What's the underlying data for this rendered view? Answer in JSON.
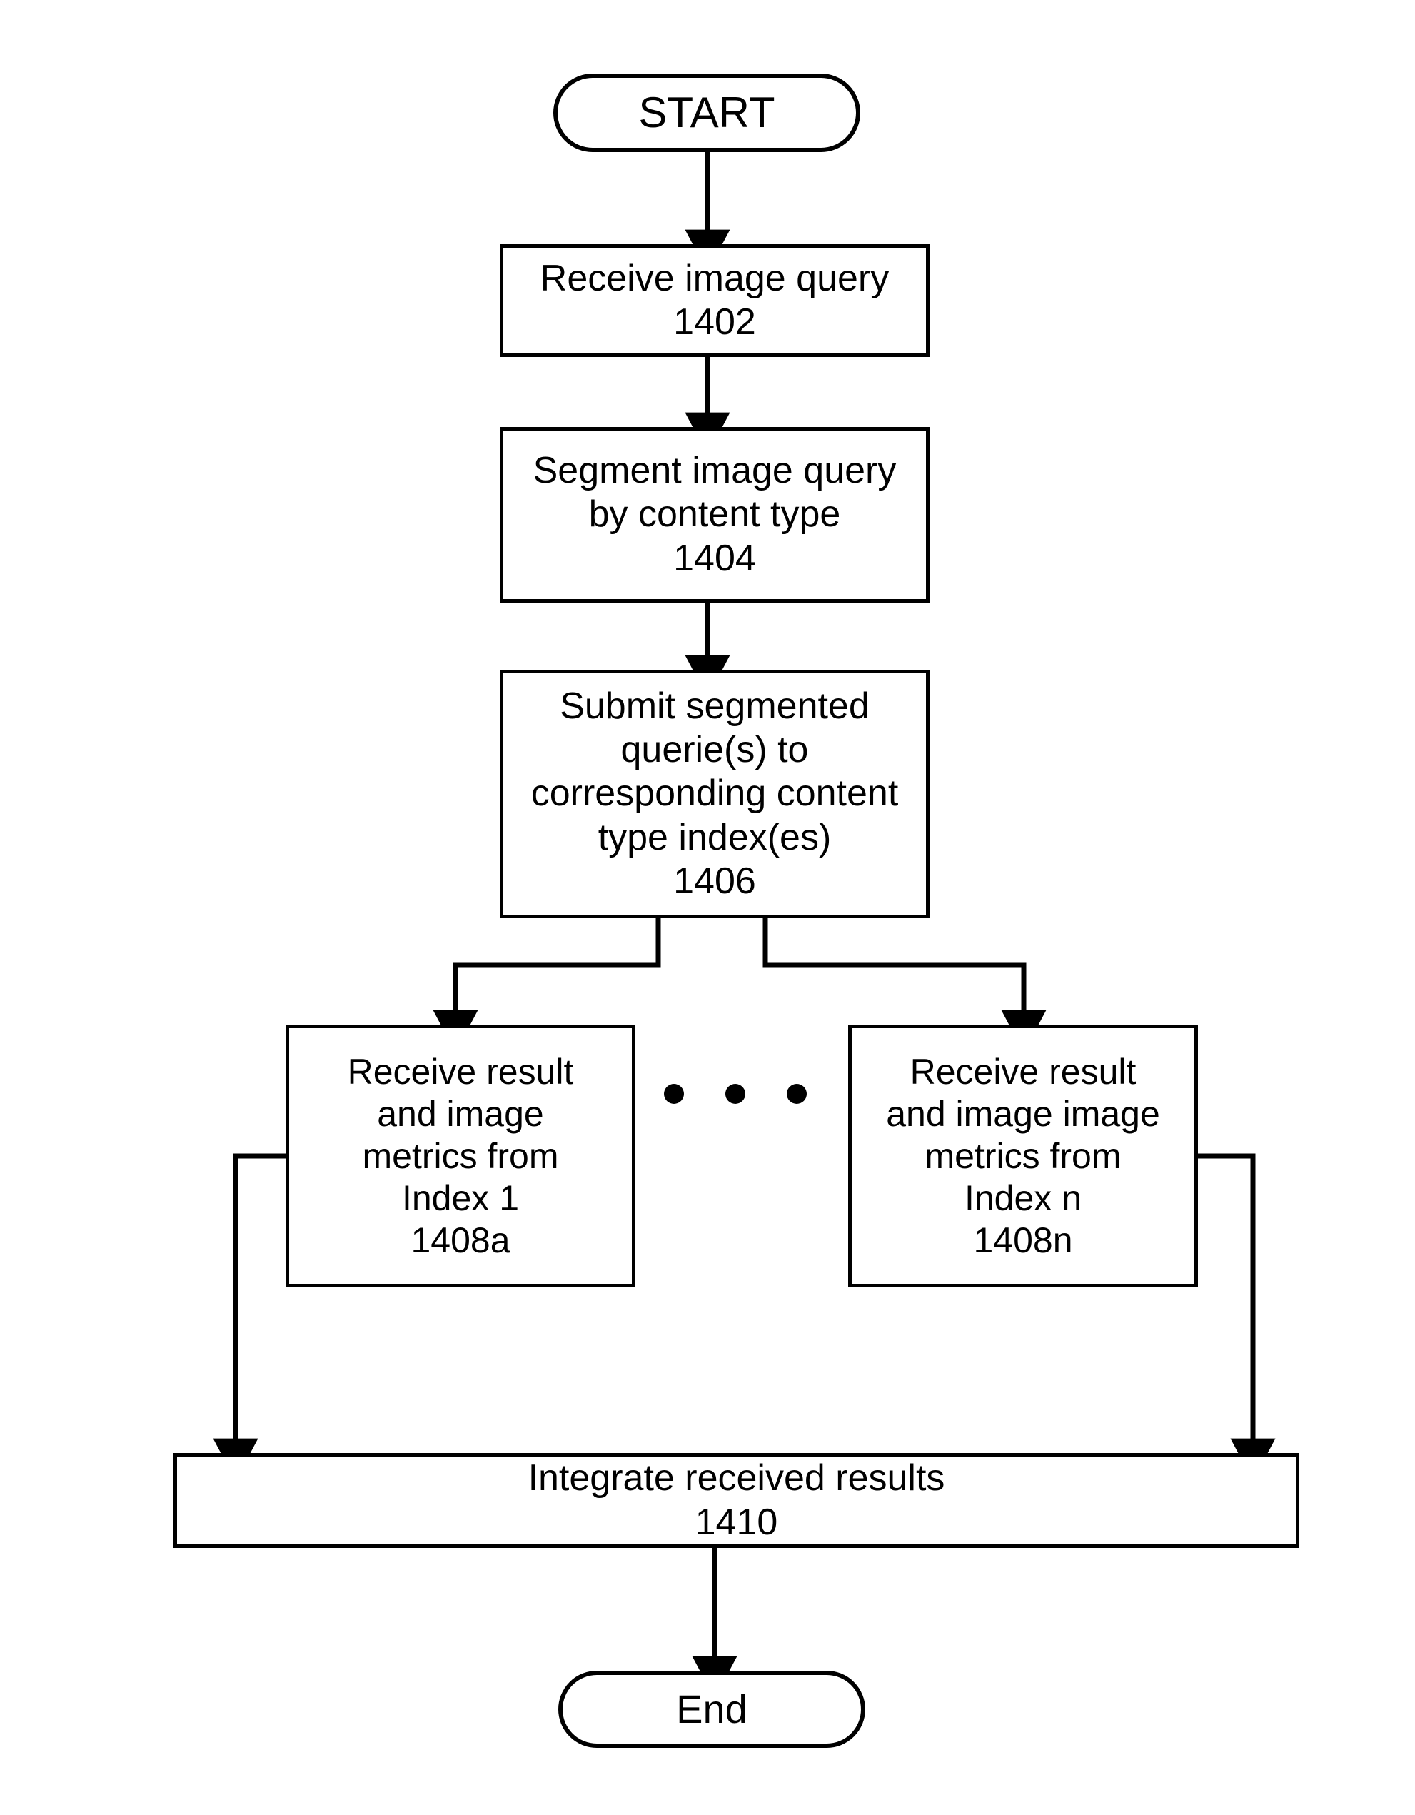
{
  "diagram": {
    "type": "flowchart",
    "title": "Image query segmentation and result integration process",
    "orientation": "top-to-bottom",
    "stroke_color": "#000000",
    "background_color": "#ffffff",
    "nodes": {
      "start": {
        "shape": "terminator",
        "label": "START"
      },
      "step_1402": {
        "shape": "process",
        "label": "Receive image query\n1402",
        "ref": "1402"
      },
      "step_1404": {
        "shape": "process",
        "label": "Segment image query\nby content type\n1404",
        "ref": "1404"
      },
      "step_1406": {
        "shape": "process",
        "label": "Submit segmented\nquerie(s) to\ncorresponding content\ntype index(es)\n1406",
        "ref": "1406"
      },
      "step_1408a": {
        "shape": "process",
        "label": "Receive result\nand image\nmetrics from\nIndex 1\n1408a",
        "ref": "1408a"
      },
      "step_1408n": {
        "shape": "process",
        "label": "Receive result\nand image image\nmetrics from\nIndex n\n1408n",
        "ref": "1408n"
      },
      "step_1410": {
        "shape": "process",
        "label": "Integrate received results\n1410",
        "ref": "1410"
      },
      "end": {
        "shape": "terminator",
        "label": "End"
      }
    },
    "ellipsis": {
      "name": "horizontal-ellipsis",
      "dot_count": 3,
      "meaning": "additional parallel index branches"
    },
    "edges": [
      {
        "from": "start",
        "to": "step_1402",
        "style": "straight-down-arrow"
      },
      {
        "from": "step_1402",
        "to": "step_1404",
        "style": "straight-down-arrow"
      },
      {
        "from": "step_1404",
        "to": "step_1406",
        "style": "straight-down-arrow"
      },
      {
        "from": "step_1406",
        "to": "step_1408a",
        "style": "branch-left-elbow-arrow"
      },
      {
        "from": "step_1406",
        "to": "step_1408n",
        "style": "branch-right-elbow-arrow"
      },
      {
        "from": "step_1408a",
        "to": "step_1410",
        "style": "left-side-elbow-arrow"
      },
      {
        "from": "step_1408n",
        "to": "step_1410",
        "style": "right-side-elbow-arrow"
      },
      {
        "from": "step_1410",
        "to": "end",
        "style": "straight-down-arrow"
      }
    ]
  }
}
